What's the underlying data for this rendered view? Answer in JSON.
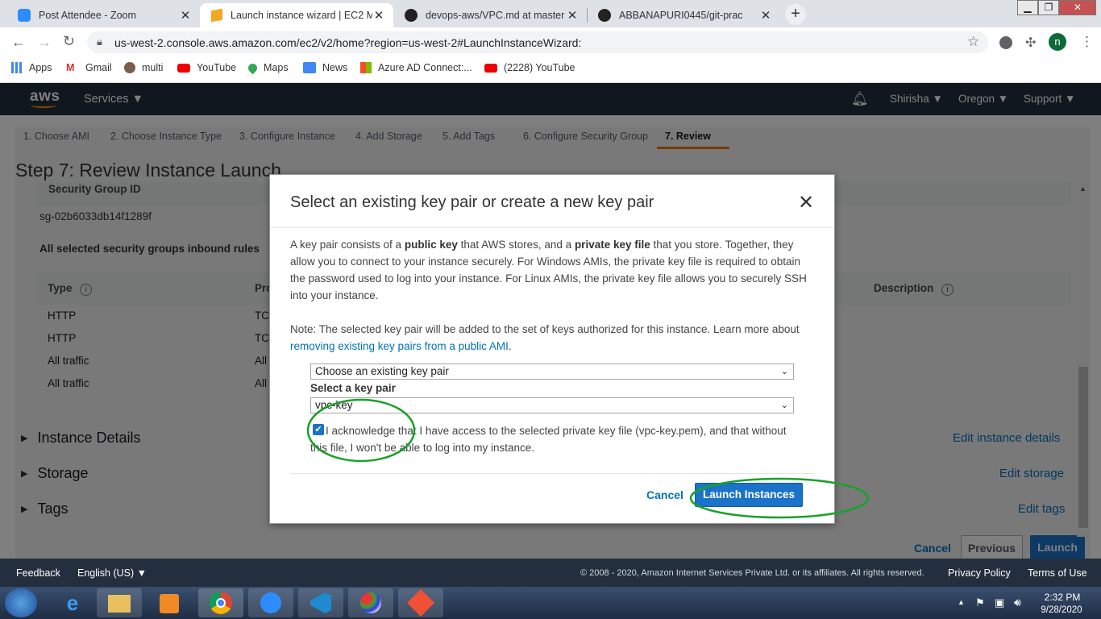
{
  "browser": {
    "tabs": [
      {
        "title": "Post Attendee - Zoom",
        "icon": "zoom-icon",
        "active": false
      },
      {
        "title": "Launch instance wizard | EC2 Ma",
        "icon": "aws-box-icon",
        "active": true
      },
      {
        "title": "devops-aws/VPC.md at master · A",
        "icon": "github-icon",
        "active": false
      },
      {
        "title": "ABBANAPURI0445/git-prac",
        "icon": "github-icon",
        "active": false
      }
    ],
    "url": "us-west-2.console.aws.amazon.com/ec2/v2/home?region=us-west-2#LaunchInstanceWizard:",
    "profile_initial": "n",
    "bookmarks": [
      "Apps",
      "Gmail",
      "multi",
      "YouTube",
      "Maps",
      "News",
      "Azure AD Connect:...",
      "(2228) YouTube"
    ]
  },
  "aws_nav": {
    "logo": "aws",
    "services": "Services",
    "user": "Shirisha",
    "region": "Oregon",
    "support": "Support"
  },
  "wizard": {
    "steps": [
      "1. Choose AMI",
      "2. Choose Instance Type",
      "3. Configure Instance",
      "4. Add Storage",
      "5. Add Tags",
      "6. Configure Security Group",
      "7. Review"
    ],
    "active_step": "7. Review",
    "title": "Step 7: Review Instance Launch",
    "security_group_id_label": "Security Group ID",
    "security_group_id": "sg-02b6033db14f1289f",
    "inbound_rules_label": "All selected security groups inbound rules",
    "table": {
      "col_type": "Type",
      "col_protocol": "Pro",
      "col_description": "Description",
      "rows": [
        {
          "type": "HTTP",
          "protocol": "TC"
        },
        {
          "type": "HTTP",
          "protocol": "TC"
        },
        {
          "type": "All traffic",
          "protocol": "All"
        },
        {
          "type": "All traffic",
          "protocol": "All"
        }
      ]
    },
    "sections": [
      {
        "label": "Instance Details",
        "edit": "Edit instance details"
      },
      {
        "label": "Storage",
        "edit": "Edit storage"
      },
      {
        "label": "Tags",
        "edit": "Edit tags"
      }
    ],
    "cancel": "Cancel",
    "previous": "Previous",
    "launch": "Launch"
  },
  "modal": {
    "title": "Select an existing key pair or create a new key pair",
    "para1_a": "A key pair consists of a ",
    "para1_b": "public key",
    "para1_c": " that AWS stores, and a ",
    "para1_d": "private key file",
    "para1_e": " that you store. Together, they allow you to connect to your instance securely. For Windows AMIs, the private key file is required to obtain the password used to log into your instance. For Linux AMIs, the private key file allows you to securely SSH into your instance.",
    "para2": "Note: The selected key pair will be added to the set of keys authorized for this instance. Learn more about",
    "para2_link": "removing existing key pairs from a public AMI",
    "para2_end": ".",
    "keypair_mode": "Choose an existing key pair",
    "select_label": "Select a key pair",
    "selected_key": "vpc-key",
    "ack_checked": true,
    "ack_text": "I acknowledge that I have access to the selected private key file (vpc-key.pem), and that without this file, I won't be able to log into my instance.",
    "cancel": "Cancel",
    "launch": "Launch Instances"
  },
  "footer": {
    "feedback": "Feedback",
    "language": "English (US)",
    "copyright": "© 2008 - 2020, Amazon Internet Services Private Ltd. or its affiliates. All rights reserved.",
    "privacy": "Privacy Policy",
    "terms": "Terms of Use"
  },
  "taskbar": {
    "time": "2:32 PM",
    "date": "9/28/2020"
  },
  "colors": {
    "aws_nav": "#232f3e",
    "link": "#0073bb",
    "primary_button": "#1a73c8",
    "annotation": "#1aa02a"
  }
}
